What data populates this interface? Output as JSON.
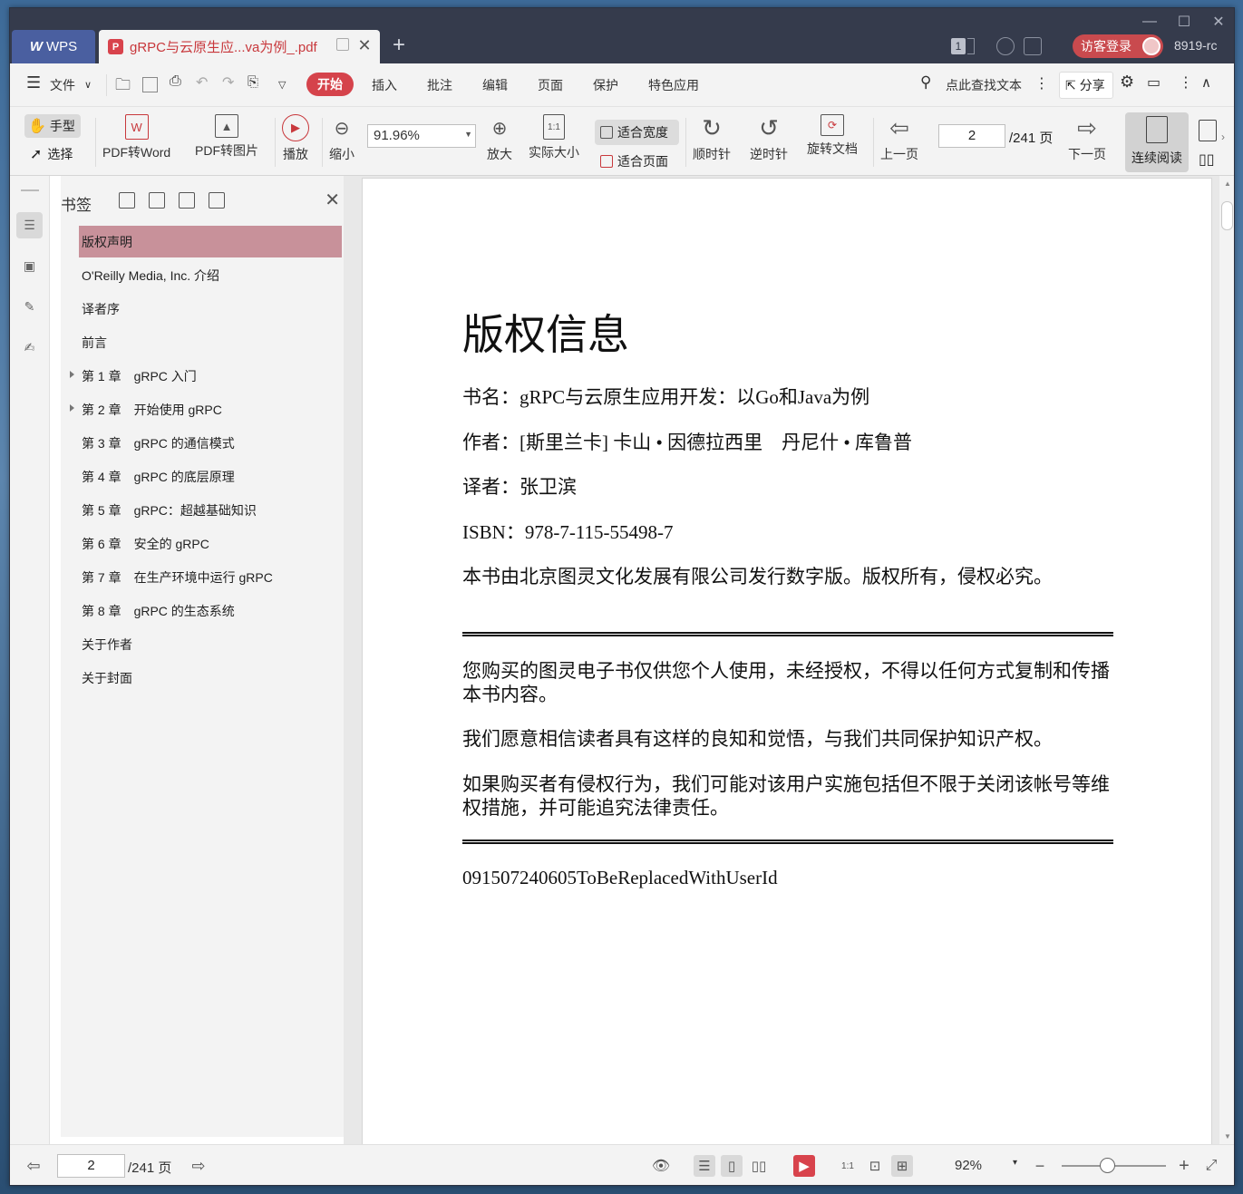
{
  "titlebar": {
    "app_tab": "WPS",
    "doc_tab": "gRPC与云原生应...va为例_.pdf",
    "page_badge": "1",
    "login_label": "访客登录",
    "user_id": "8919-rc"
  },
  "menu": {
    "file": "文件",
    "items": [
      "开始",
      "插入",
      "批注",
      "编辑",
      "页面",
      "保护",
      "特色应用"
    ],
    "search": "点此查找文本",
    "share": "分享"
  },
  "ribbon": {
    "hand": "手型",
    "select": "选择",
    "pdf2word": "PDF转Word",
    "pdf2img": "PDF转图片",
    "play": "播放",
    "zoom_out": "缩小",
    "zoom_value": "91.96%",
    "zoom_in": "放大",
    "actual_size": "实际大小",
    "fit_width": "适合宽度",
    "fit_page": "适合页面",
    "cw": "顺时针",
    "ccw": "逆时针",
    "rotate": "旋转文档",
    "prev": "上一页",
    "page": "2",
    "total": "/241 页",
    "next": "下一页",
    "continuous": "连续阅读"
  },
  "panel": {
    "title": "书签",
    "items": [
      "版权声明",
      "O'Reilly Media, Inc. 介绍",
      "译者序",
      "前言",
      "第 1 章　gRPC 入门",
      "第 2 章　开始使用 gRPC",
      "第 3 章　gRPC 的通信模式",
      "第 4 章　gRPC 的底层原理",
      "第 5 章　gRPC：超越基础知识",
      "第 6 章　安全的 gRPC",
      "第 7 章　在生产环境中运行 gRPC",
      "第 8 章　gRPC 的生态系统",
      "关于作者",
      "关于封面"
    ]
  },
  "document": {
    "title": "版权信息",
    "book": "书名：gRPC与云原生应用开发：以Go和Java为例",
    "authors": "作者：[斯里兰卡] 卡山 • 因德拉西里　丹尼什 • 库鲁普",
    "translator": "译者：张卫滨",
    "isbn": "ISBN：978-7-115-55498-7",
    "rights": "本书由北京图灵文化发展有限公司发行数字版。版权所有，侵权必究。",
    "p1": "您购买的图灵电子书仅供您个人使用，未经授权，不得以任何方式复制和传播本书内容。",
    "p2": "我们愿意相信读者具有这样的良知和觉悟，与我们共同保护知识产权。",
    "p3": "如果购买者有侵权行为，我们可能对该用户实施包括但不限于关闭该帐号等维权措施，并可能追究法律责任。",
    "userid": "091507240605ToBeReplacedWithUserId"
  },
  "status": {
    "page": "2",
    "total": "/241 页",
    "zoom": "92%"
  },
  "colors": {
    "accent": "#d5434b",
    "selected_bookmark": "#c8919a",
    "titlebar": "#353b4c"
  }
}
